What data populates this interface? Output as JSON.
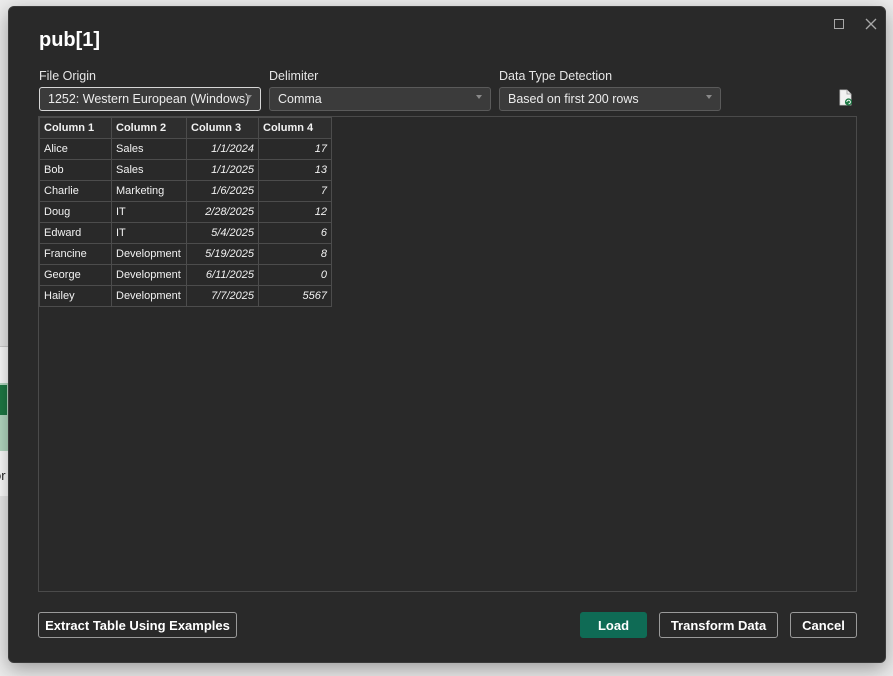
{
  "background_app": {
    "partial_text": "or"
  },
  "dialog": {
    "title": "pub[1]",
    "window_controls": {
      "maximize_icon": "maximize-icon",
      "close_icon": "close-icon"
    }
  },
  "options": {
    "file_origin": {
      "label": "File Origin",
      "value": "1252: Western European (Windows)"
    },
    "delimiter": {
      "label": "Delimiter",
      "value": "Comma"
    },
    "data_type_detection": {
      "label": "Data Type Detection",
      "value": "Based on first 200 rows"
    },
    "refresh_icon": "refresh-preview-icon"
  },
  "table": {
    "headers": [
      "Column 1",
      "Column 2",
      "Column 3",
      "Column 4"
    ],
    "rows": [
      [
        "Alice",
        "Sales",
        "1/1/2024",
        "17"
      ],
      [
        "Bob",
        "Sales",
        "1/1/2025",
        "13"
      ],
      [
        "Charlie",
        "Marketing",
        "1/6/2025",
        "7"
      ],
      [
        "Doug",
        "IT",
        "2/28/2025",
        "12"
      ],
      [
        "Edward",
        "IT",
        "5/4/2025",
        "6"
      ],
      [
        "Francine",
        "Development",
        "5/19/2025",
        "8"
      ],
      [
        "George",
        "Development",
        "6/11/2025",
        "0"
      ],
      [
        "Hailey",
        "Development",
        "7/7/2025",
        "5567"
      ]
    ]
  },
  "buttons": {
    "extract": "Extract Table Using Examples",
    "load": "Load",
    "transform": "Transform Data",
    "cancel": "Cancel"
  },
  "colors": {
    "dialog_bg": "#292929",
    "primary_button": "#0f6b55",
    "background_accent": "#1e7a45"
  }
}
